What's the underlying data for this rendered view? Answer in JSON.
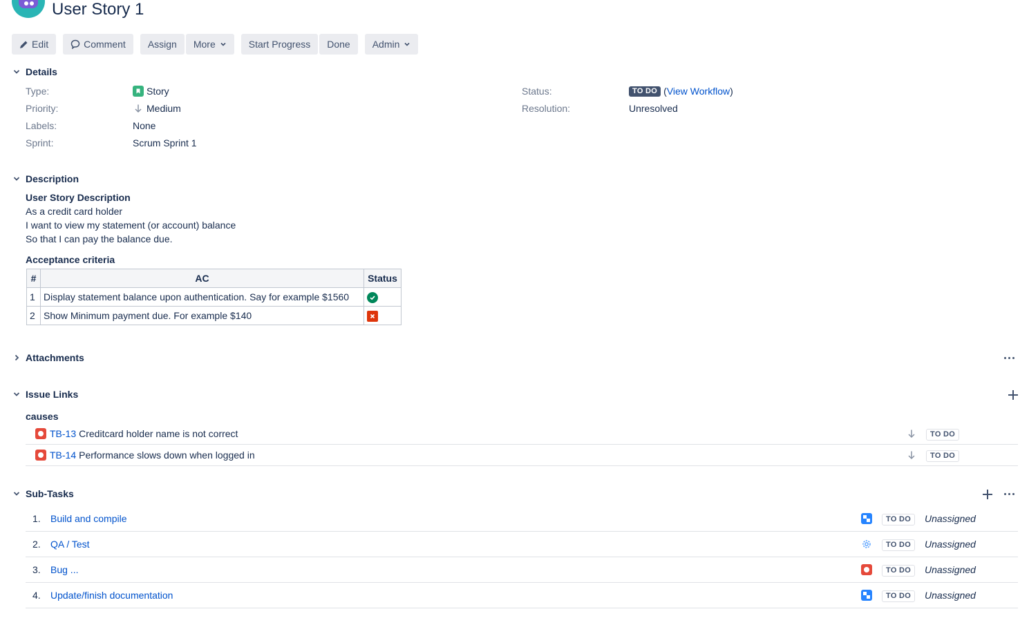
{
  "issue": {
    "title": "User Story 1"
  },
  "toolbar": {
    "edit": "Edit",
    "comment": "Comment",
    "assign": "Assign",
    "more": "More",
    "start_progress": "Start Progress",
    "done": "Done",
    "admin": "Admin"
  },
  "details": {
    "heading": "Details",
    "type_label": "Type:",
    "type_value": "Story",
    "priority_label": "Priority:",
    "priority_value": "Medium",
    "labels_label": "Labels:",
    "labels_value": "None",
    "sprint_label": "Sprint:",
    "sprint_value": "Scrum Sprint 1",
    "status_label": "Status:",
    "status_value": "TO DO",
    "view_workflow_open": "(",
    "view_workflow": "View Workflow",
    "view_workflow_close": ")",
    "resolution_label": "Resolution:",
    "resolution_value": "Unresolved"
  },
  "description": {
    "heading": "Description",
    "subtitle": "User Story Description",
    "line1": "As a credit card holder",
    "line2": "I want to view my statement (or account) balance",
    "line3": "So that I can pay the balance due.",
    "ac_heading": "Acceptance criteria",
    "table": {
      "headers": [
        "#",
        "AC",
        "Status"
      ],
      "rows": [
        {
          "num": "1",
          "ac": "Display statement balance upon authentication. Say for example $1560",
          "status_icon": "check-circle-icon",
          "status_color": "#00875a"
        },
        {
          "num": "2",
          "ac": "Show Minimum payment due. For example $140",
          "status_icon": "cross-square-icon",
          "status_color": "#de350b"
        }
      ]
    }
  },
  "attachments": {
    "heading": "Attachments"
  },
  "issue_links": {
    "heading": "Issue Links",
    "group": "causes",
    "items": [
      {
        "key": "TB-13",
        "summary": "Creditcard holder name is not correct",
        "status": "TO DO"
      },
      {
        "key": "TB-14",
        "summary": "Performance slows down when logged in",
        "status": "TO DO"
      }
    ]
  },
  "subtasks": {
    "heading": "Sub-Tasks",
    "items": [
      {
        "num": "1.",
        "title": "Build and compile",
        "icon": "subtask-icon",
        "status": "TO DO",
        "assignee": "Unassigned"
      },
      {
        "num": "2.",
        "title": "QA / Test",
        "icon": "gear-icon",
        "status": "TO DO",
        "assignee": "Unassigned"
      },
      {
        "num": "3.",
        "title": "Bug ...",
        "icon": "bug-icon",
        "status": "TO DO",
        "assignee": "Unassigned"
      },
      {
        "num": "4.",
        "title": "Update/finish documentation",
        "icon": "subtask-icon",
        "status": "TO DO",
        "assignee": "Unassigned"
      }
    ]
  },
  "colors": {
    "link": "#0052cc",
    "text": "#172b4d",
    "muted": "#6b778c",
    "button_bg": "#ebecf0",
    "story_green": "#36b37e",
    "bug_red": "#e5493a",
    "subtask_blue": "#2684ff"
  }
}
